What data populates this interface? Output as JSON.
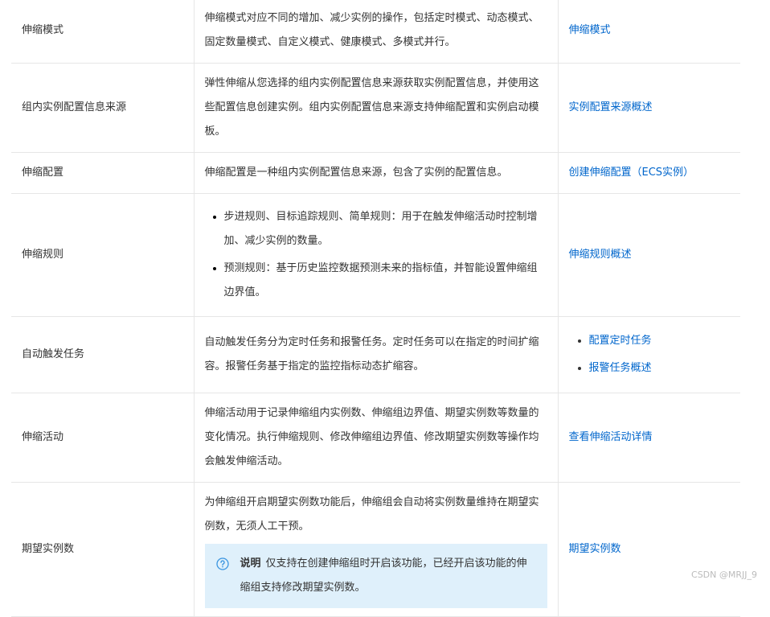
{
  "rows": [
    {
      "term": "伸缩模式",
      "desc": "伸缩模式对应不同的增加、减少实例的操作，包括定时模式、动态模式、固定数量模式、自定义模式、健康模式、多模式并行。",
      "link": "伸缩模式"
    },
    {
      "term": "组内实例配置信息来源",
      "desc": "弹性伸缩从您选择的组内实例配置信息来源获取实例配置信息，并使用这些配置信息创建实例。组内实例配置信息来源支持伸缩配置和实例启动模板。",
      "link": "实例配置来源概述"
    },
    {
      "term": "伸缩配置",
      "desc": "伸缩配置是一种组内实例配置信息来源，包含了实例的配置信息。",
      "link": "创建伸缩配置（ECS实例）"
    },
    {
      "term": "伸缩规则",
      "bullets": [
        "步进规则、目标追踪规则、简单规则：用于在触发伸缩活动时控制增加、减少实例的数量。",
        "预测规则：基于历史监控数据预测未来的指标值，并智能设置伸缩组边界值。"
      ],
      "link": "伸缩规则概述"
    },
    {
      "term": "自动触发任务",
      "desc": "自动触发任务分为定时任务和报警任务。定时任务可以在指定的时间扩缩容。报警任务基于指定的监控指标动态扩缩容。",
      "links": [
        "配置定时任务",
        "报警任务概述"
      ]
    },
    {
      "term": "伸缩活动",
      "desc": "伸缩活动用于记录伸缩组内实例数、伸缩组边界值、期望实例数等数量的变化情况。执行伸缩规则、修改伸缩组边界值、修改期望实例数等操作均会触发伸缩活动。",
      "link": "查看伸缩活动详情"
    },
    {
      "term": "期望实例数",
      "desc": "为伸缩组开启期望实例数功能后，伸缩组会自动将实例数量维持在期望实例数，无须人工干预。",
      "note_label": "说明",
      "note_text": "仅支持在创建伸缩组时开启该功能，已经开启该功能的伸缩组支持修改期望实例数。",
      "link": "期望实例数"
    }
  ],
  "watermark": "CSDN @MRJJ_9",
  "colors": {
    "link": "#0066cc",
    "note_bg": "#dff0fb",
    "border": "#e6e6e6"
  }
}
